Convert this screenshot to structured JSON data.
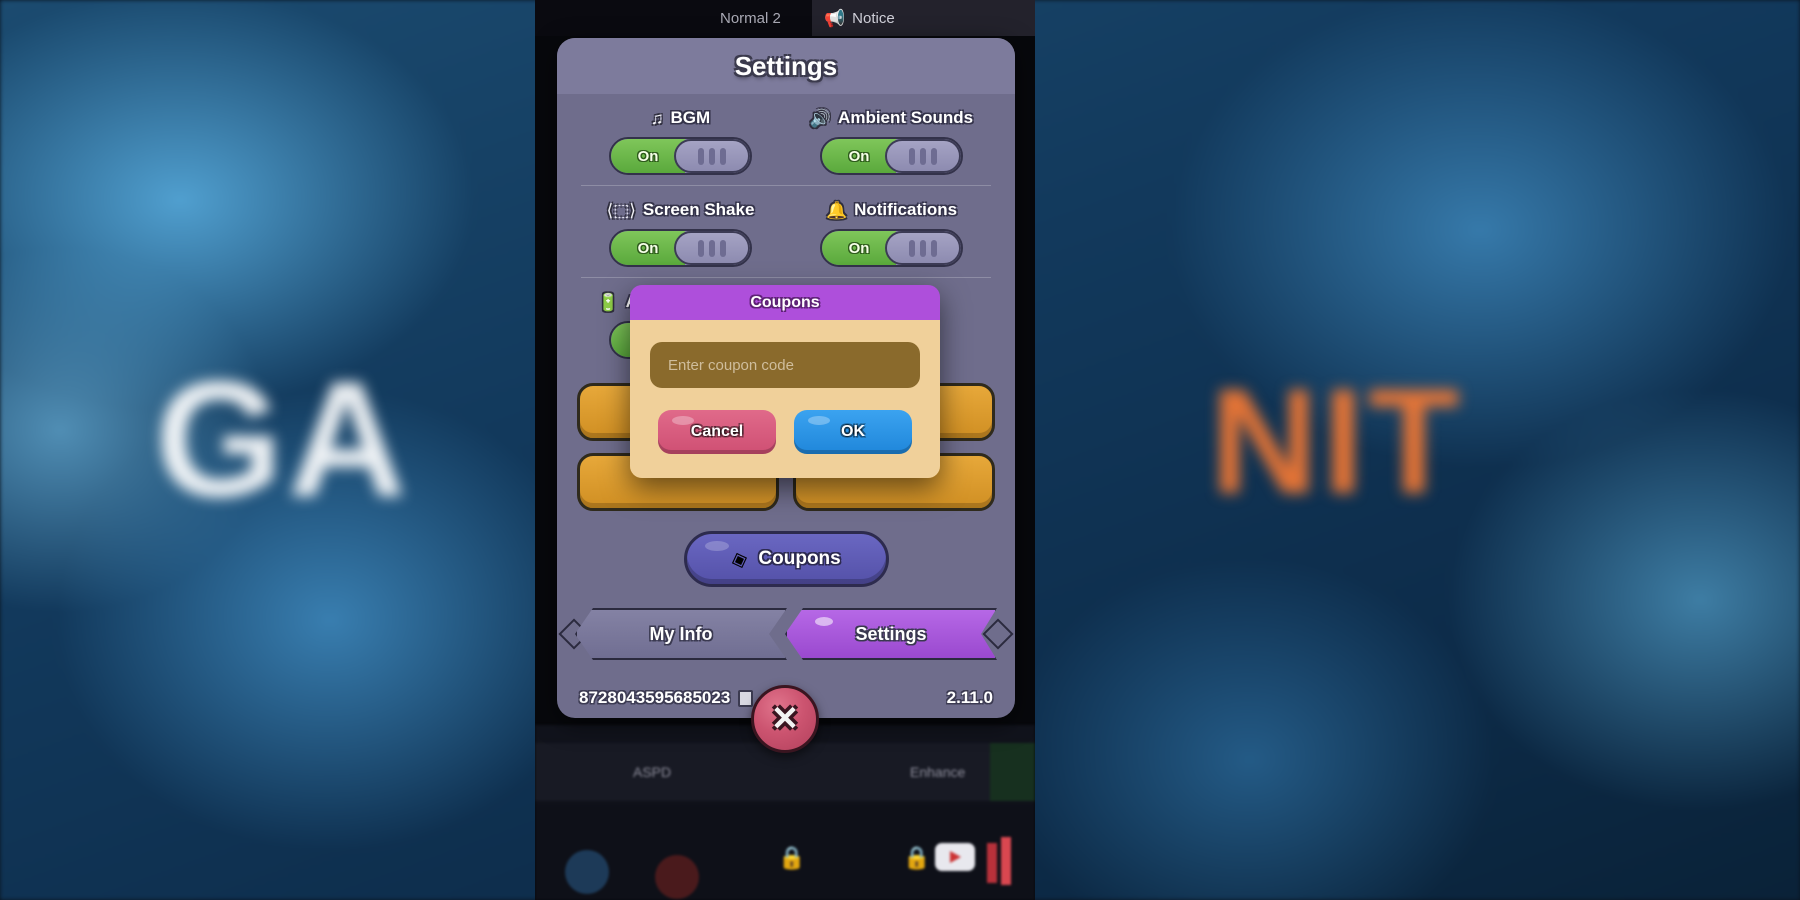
{
  "background": {
    "word_left": "GA",
    "word_right": "NIT"
  },
  "game_topbar": {
    "mode_label": "Normal 2",
    "notice_label": "Notice",
    "megaphone_icon": "megaphone-icon"
  },
  "game_hud": {
    "aspd_label": "ASPD",
    "enhance_label": "Enhance"
  },
  "settings": {
    "title": "Settings",
    "toggles": [
      {
        "label": "BGM",
        "icon": "♫",
        "icon_name": "music-note-icon",
        "state": "On"
      },
      {
        "label": "Ambient Sounds",
        "icon": "🔊",
        "icon_name": "speaker-icon",
        "state": "On"
      },
      {
        "label": "Screen Shake",
        "icon": "⟨⬚⟩",
        "icon_name": "screen-shake-icon",
        "state": "On"
      },
      {
        "label": "Notifications",
        "icon": "🔔",
        "icon_name": "bell-icon",
        "state": "On"
      },
      {
        "label": "Auto Sleep Mode",
        "icon": "🔋",
        "icon_name": "battery-icon",
        "state": "On"
      }
    ],
    "action_buttons": [
      {
        "label": ""
      },
      {
        "label": ""
      },
      {
        "label": ""
      },
      {
        "label": ""
      }
    ],
    "coupons_button": {
      "label": "Coupons",
      "icon": "◈",
      "icon_name": "ticket-icon"
    },
    "tabs": [
      {
        "label": "My Info",
        "active": false
      },
      {
        "label": "Settings",
        "active": true
      }
    ],
    "footer": {
      "player_id": "8728043595685023",
      "copy_icon_name": "copy-icon",
      "version": "2.11.0"
    }
  },
  "coupon_modal": {
    "title": "Coupons",
    "input_placeholder": "Enter coupon code",
    "input_value": "",
    "cancel_label": "Cancel",
    "ok_label": "OK"
  },
  "close_button": {
    "glyph": "✕"
  },
  "colors": {
    "panel_bg": "#6f6d8c",
    "panel_header": "#7d7b9c",
    "toggle_on": "#6fbb48",
    "orange_button": "#e7a83a",
    "coupons_purple": "#6a67c2",
    "tab_active": "#b668e6",
    "modal_header": "#ae4fdb",
    "modal_body": "#f0d09a",
    "modal_input": "#8a6a2c",
    "cancel_pink": "#cf4f73",
    "ok_blue": "#1f86da",
    "close_red": "#cc5470"
  }
}
